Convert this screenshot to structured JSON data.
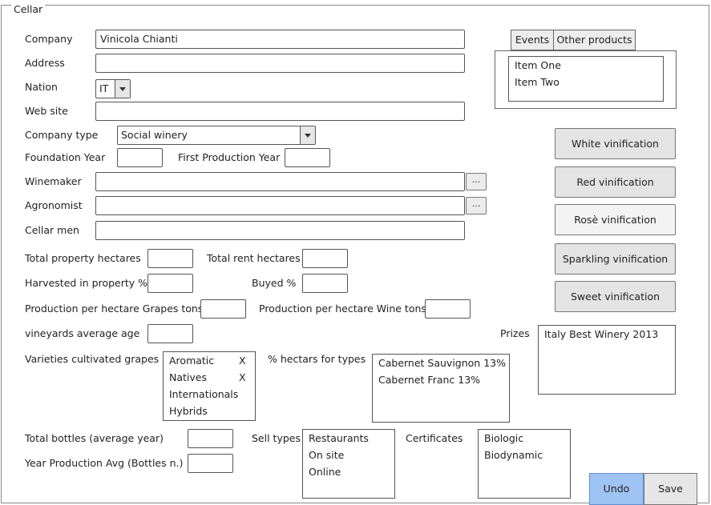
{
  "window": {
    "title": "Cellar"
  },
  "form": {
    "company_label": "Company",
    "company_value": "Vinicola Chianti",
    "address_label": "Address",
    "address_value": "",
    "nation_label": "Nation",
    "nation_value": "IT",
    "website_label": "Web site",
    "website_value": "",
    "company_type_label": "Company type",
    "company_type_value": "Social winery",
    "foundation_year_label": "Foundation Year",
    "first_production_year_label": "First Production Year",
    "winemaker_label": "Winemaker",
    "agronomist_label": "Agronomist",
    "cellar_men_label": "Cellar men",
    "ellipsis_label": "...",
    "total_property_hectares_label": "Total property hectares",
    "total_rent_hectares_label": "Total rent hectares",
    "harvested_in_property_label": "Harvested in property %",
    "buyed_label": "Buyed %",
    "production_grapes_label": "Production per hectare Grapes tons",
    "production_wine_label": "Production per hectare Wine tons",
    "vineyards_age_label": "vineyards average age",
    "varieties_label": "Varieties cultivated grapes",
    "hectars_types_label": "% hectars for types",
    "prizes_label": "Prizes",
    "total_bottles_label": "Total bottles (average year)",
    "year_production_label": "Year Production Avg (Bottles n.)",
    "sell_types_label": "Sell types",
    "certificates_label": "Certificates"
  },
  "tabs": [
    {
      "label": "Events"
    },
    {
      "label": "Other products"
    }
  ],
  "tab_list": [
    "Item One",
    "Item Two"
  ],
  "vinification_buttons": [
    {
      "label": "White vinification"
    },
    {
      "label": "Red vinification"
    },
    {
      "label": "Rosè vinification"
    },
    {
      "label": "Sparkling vinification"
    },
    {
      "label": "Sweet vinification"
    }
  ],
  "varieties": [
    {
      "label": "Aromatic",
      "mark": "X"
    },
    {
      "label": "Natives",
      "mark": "X"
    },
    {
      "label": "Internationals",
      "mark": ""
    },
    {
      "label": "Hybrids",
      "mark": ""
    }
  ],
  "hectars_types": [
    "Cabernet Sauvignon 13%",
    "Cabernet Franc 13%"
  ],
  "prizes": [
    "Italy Best Winery 2013"
  ],
  "sell_types": [
    "Restaurants",
    "On site",
    "Online"
  ],
  "certificates": [
    "Biologic",
    "Biodynamic"
  ],
  "actions": {
    "undo_label": "Undo",
    "save_label": "Save"
  },
  "colors": {
    "undo_bg": "#9fc3f2",
    "border": "#555555"
  }
}
